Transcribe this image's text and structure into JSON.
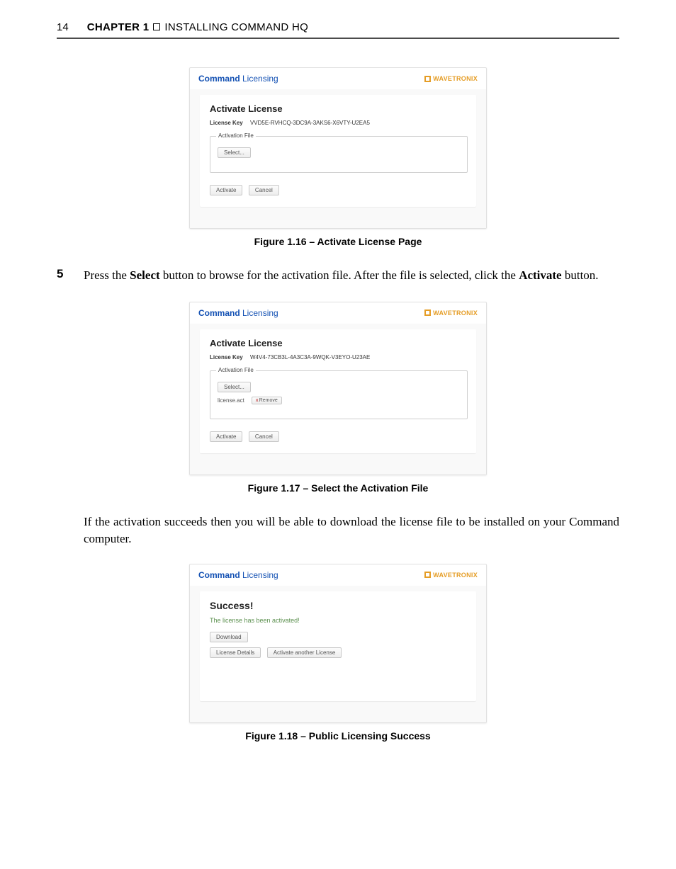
{
  "header": {
    "page_number": "14",
    "chapter_label": "CHAPTER 1",
    "chapter_title": "INSTALLING COMMAND HQ"
  },
  "fig1": {
    "brand_bold": "Command",
    "brand_light": " Licensing",
    "brand_right": "WAVETRONIX",
    "heading": "Activate License",
    "license_key_label": "License Key",
    "license_key_value": "VVD5E-RVHCQ-3DC9A-3AKS6-X6VTY-U2EA5",
    "fieldset_legend": "Activation File",
    "select_btn": "Select...",
    "activate_btn": "Activate",
    "cancel_btn": "Cancel",
    "caption": "Figure 1.16 – Activate License Page"
  },
  "step5": {
    "num": "5",
    "text_a": "Press the ",
    "bold_a": "Select",
    "text_b": " button to browse for the activation file. After the file is selected, click the ",
    "bold_b": "Activate",
    "text_c": " button."
  },
  "fig2": {
    "brand_bold": "Command",
    "brand_light": " Licensing",
    "brand_right": "WAVETRONIX",
    "heading": "Activate License",
    "license_key_label": "License Key",
    "license_key_value": "W4V4-73CB3L-4A3C3A-9WQK-V3EYO-U23AE",
    "fieldset_legend": "Activation File",
    "select_btn": "Select...",
    "file_name": "license.act",
    "remove_btn": "Remove",
    "activate_btn": "Activate",
    "cancel_btn": "Cancel",
    "caption": "Figure 1.17 – Select the Activation File"
  },
  "para2": {
    "text": "If the activation succeeds then you will be able to download the license file to be installed on your Command computer."
  },
  "fig3": {
    "brand_bold": "Command",
    "brand_light": " Licensing",
    "brand_right": "WAVETRONIX",
    "heading": "Success!",
    "success_msg": "The license has been activated!",
    "download_btn": "Download",
    "details_btn": "License Details",
    "another_btn": "Activate another License",
    "caption": "Figure 1.18 – Public Licensing Success"
  }
}
